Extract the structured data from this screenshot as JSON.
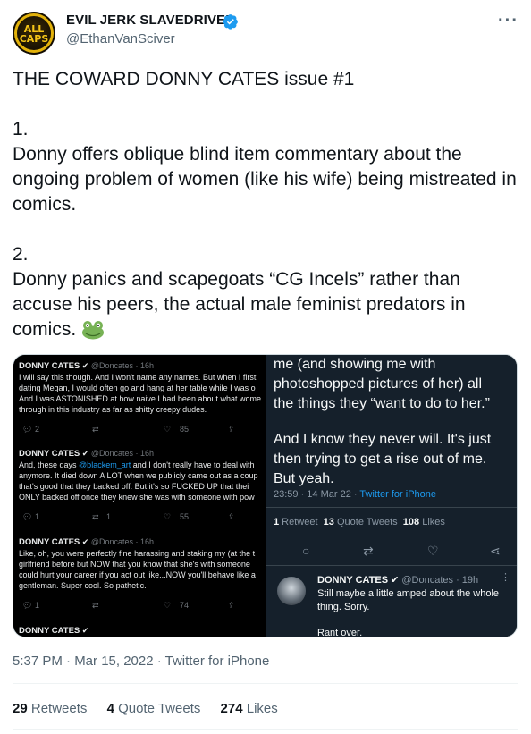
{
  "author": {
    "name": "EVIL JERK SLAVEDRIVER",
    "handle": "@EthanVanSciver",
    "avatar_text_1": "ALL",
    "avatar_text_2": "CAPS"
  },
  "tweet": {
    "title": "THE COWARD DONNY CATES issue #1",
    "point1_num": "1.",
    "point1_text": "Donny offers oblique blind item commentary about the ongoing problem of women (like his wife) being mistreated in comics.",
    "point2_num": "2.",
    "point2_text": "Donny panics and scapegoats “CG Incels” rather than accuse his peers, the actual male feminist predators in comics.",
    "emoji": "frog"
  },
  "left_screenshot": {
    "tweets": [
      {
        "name": "DONNY CATES",
        "handle": "@Doncates · 16h",
        "lines": [
          "I will say this though. And I won't name any names. But when I first",
          "dating Megan, I would often go and hang at her table while I was o",
          "And I was ASTONISHED at how naive I had been about what wome",
          "through in this industry as far as shitty creepy dudes."
        ],
        "replies": "2",
        "retweets": "",
        "likes": "85"
      },
      {
        "name": "DONNY CATES",
        "handle": "@Doncates · 16h",
        "lines_pre": "And,  these days ",
        "mention": "@blackem_art",
        "lines_post": " and I don't really have to deal with",
        "lines": [
          "anymore. It died down A LOT when we publicly came out as a coup",
          "that's good that they backed off. But it's  so FUCKED UP that thei",
          "ONLY backed off once they knew she was with someone with pow"
        ],
        "replies": "1",
        "retweets": "1",
        "likes": "55"
      },
      {
        "name": "DONNY CATES",
        "handle": "@Doncates · 16h",
        "lines": [
          "Like, oh, you were perfectly fine harassing and staking my (at the t",
          "girlfriend before but NOW that you know that she's with someone",
          "could hurt your career if you act out like...NOW you'll behave like a",
          "gentleman. Super cool. So pathetic."
        ],
        "replies": "1",
        "retweets": "",
        "likes": "74"
      },
      {
        "name": "DONNY CATES"
      }
    ]
  },
  "right_screenshot": {
    "lines": [
      "me (and showing me with",
      "photoshopped pictures of her) all",
      "the things they “want to do to her.”",
      "",
      "And I know they never will. It's just",
      "then trying to get a rise out of me.",
      "But yeah."
    ],
    "meta_time": "23:59 · 14 Mar 22 · ",
    "meta_client": "Twitter for iPhone",
    "retweets_num": "1",
    "retweets_label": " Retweet",
    "quotes_num": "13",
    "quotes_label": " Quote Tweets",
    "likes_num": "108",
    "likes_label": " Likes",
    "reply": {
      "name": "DONNY CATES",
      "handle": "@Doncates · 19h",
      "text": "Still maybe a little amped about the whole thing. Sorry.",
      "text2": "Rant over."
    }
  },
  "footer": {
    "timestamp": "5:37 PM · Mar 15, 2022 · Twitter for iPhone",
    "retweets_num": "29",
    "retweets_label": "Retweets",
    "quotes_num": "4",
    "quotes_label": "Quote Tweets",
    "likes_num": "274",
    "likes_label": "Likes"
  },
  "colors": {
    "verified": "#1d9bf0",
    "link": "#1d9bf0",
    "dim_bg": "#15202b",
    "avatar_gold": "#e3b20a"
  }
}
